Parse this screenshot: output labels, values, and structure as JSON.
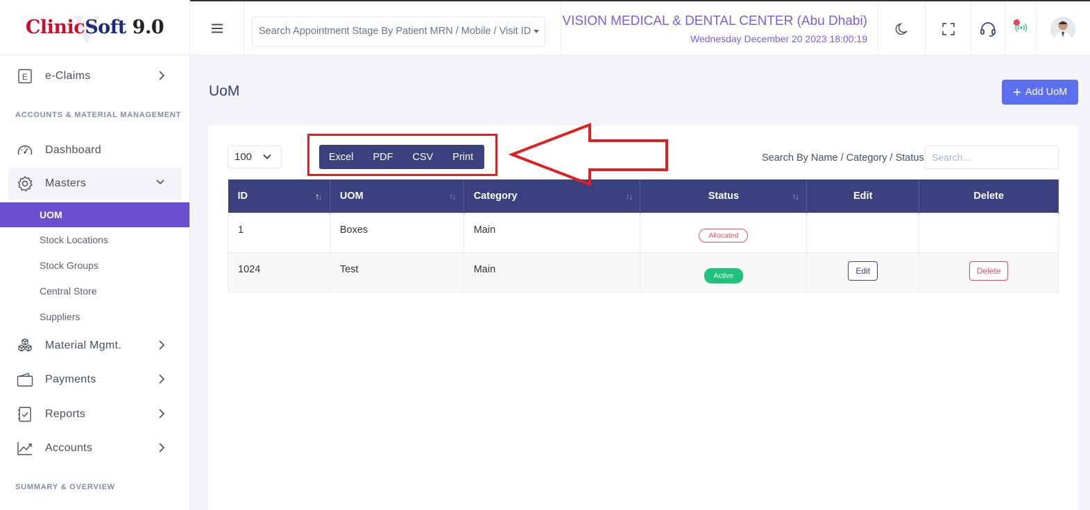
{
  "brand": {
    "logo_clinic": "Clinic",
    "logo_soft": "Soft",
    "logo_version": " 9.0",
    "logo_watermark": "V"
  },
  "sidebar": {
    "eclaims": {
      "label": "e-Claims",
      "icon": "e-icon"
    },
    "section_accounts": "ACCOUNTS & MATERIAL MANAGEMENT",
    "dashboard": {
      "label": "Dashboard",
      "icon": "speedometer-icon"
    },
    "masters": {
      "label": "Masters",
      "icon": "gear-icon"
    },
    "sub_items": [
      "UOM",
      "Stock Locations",
      "Stock Groups",
      "Central Store",
      "Suppliers"
    ],
    "material": {
      "label": "Material Mgmt.",
      "icon": "cubes-icon"
    },
    "payments": {
      "label": "Payments",
      "icon": "wallet-icon"
    },
    "reports": {
      "label": "Reports",
      "icon": "checklist-icon"
    },
    "accounts": {
      "label": "Accounts",
      "icon": "chart-line-icon"
    },
    "section_summary": "SUMMARY & OVERVIEW"
  },
  "header": {
    "search_placeholder": "Search Appointment Stage By Patient MRN / Mobile / Visit ID",
    "clinic_name": "VISION MEDICAL & DENTAL CENTER (Abu Dhabi)",
    "datetime": "Wednesday December 20 2023 18:00:19"
  },
  "page": {
    "title": "UoM",
    "add_button": "Add UoM"
  },
  "toolbar": {
    "page_length": "100",
    "export_buttons": [
      "Excel",
      "PDF",
      "CSV",
      "Print"
    ],
    "search_label": "Search By Name / Category / Status",
    "search_placeholder": "Search..."
  },
  "table": {
    "columns": [
      "ID",
      "UOM",
      "Category",
      "Status",
      "Edit",
      "Delete"
    ],
    "rows": [
      {
        "id": "1",
        "uom": "Boxes",
        "category": "Main",
        "status": "Allocated",
        "edit": "",
        "delete": ""
      },
      {
        "id": "1024",
        "uom": "Test",
        "category": "Main",
        "status": "Active",
        "edit": "Edit",
        "delete": "Delete"
      }
    ]
  },
  "colors": {
    "accent": "#6a4fcf",
    "table_header": "#3b407e",
    "primary_button": "#5b6ff0",
    "annotation": "#e02020"
  }
}
